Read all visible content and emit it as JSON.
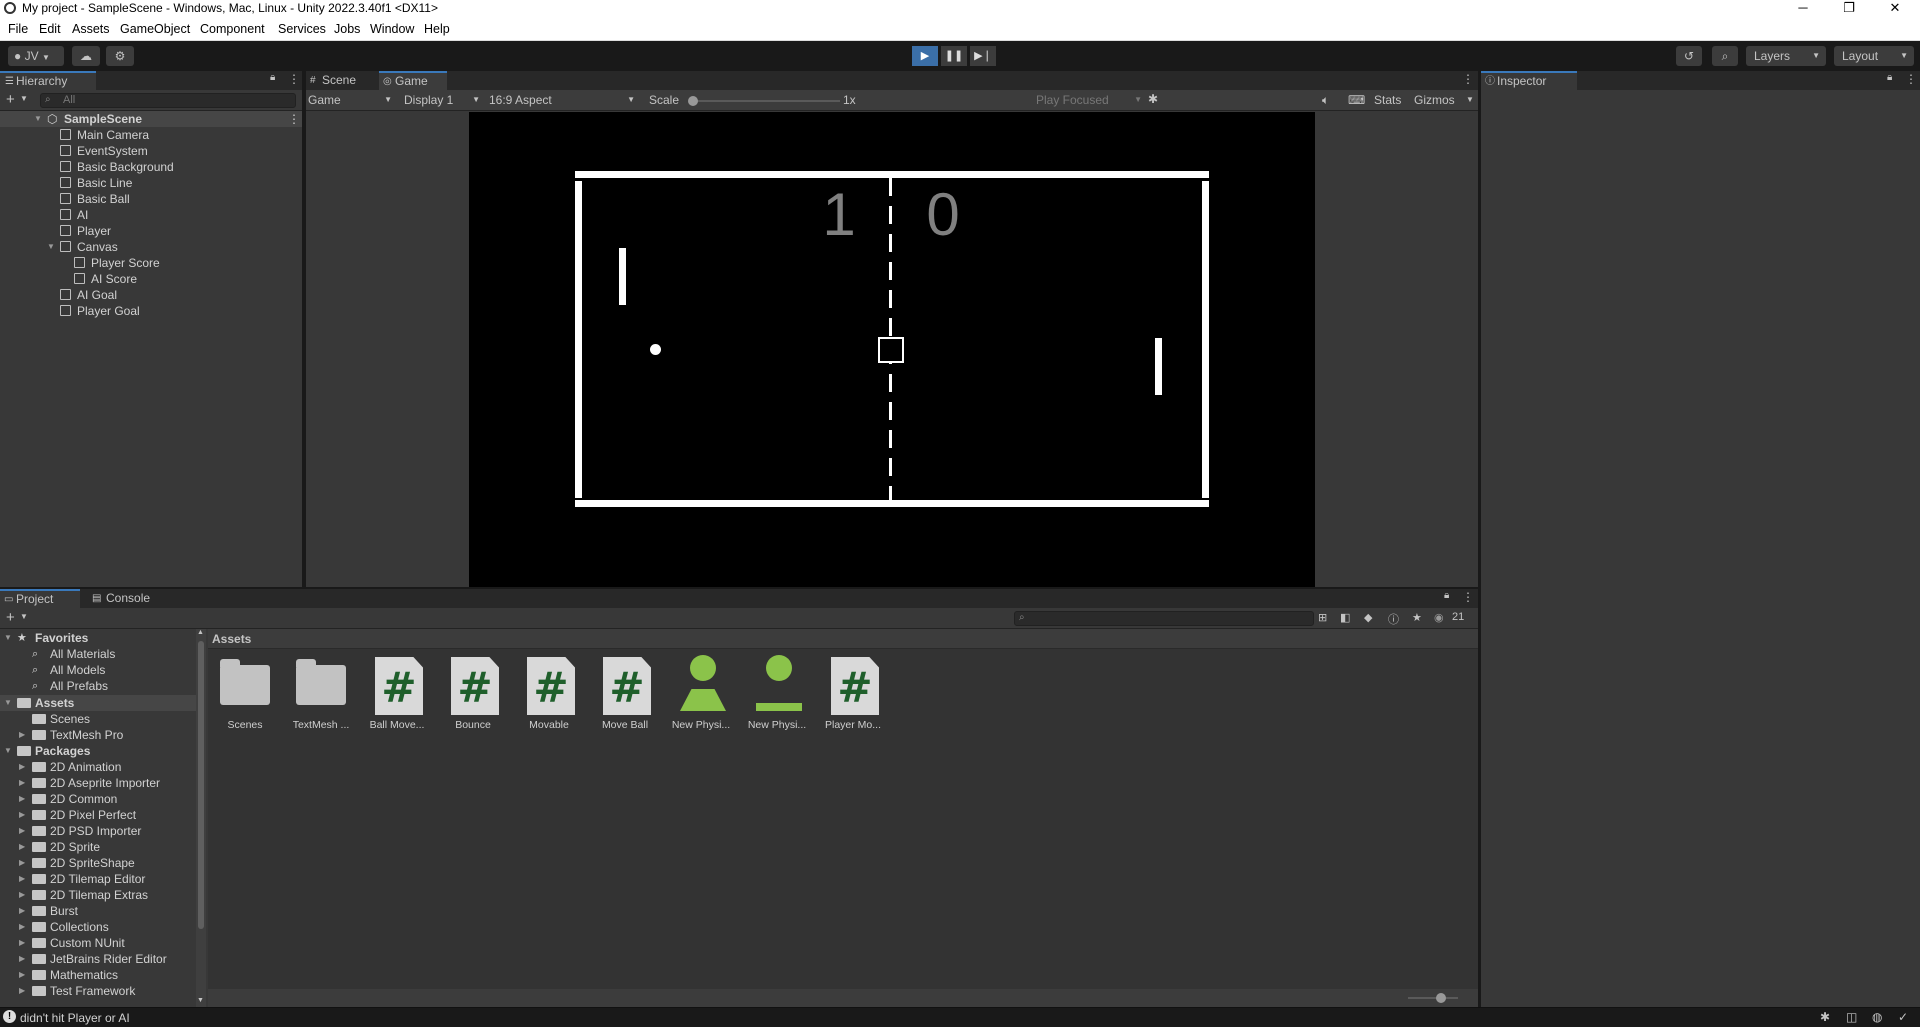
{
  "window": {
    "title": "My project - SampleScene - Windows, Mac, Linux - Unity 2022.3.40f1 <DX11>",
    "controls": [
      "─",
      "❐",
      "✕"
    ]
  },
  "menu": [
    "File",
    "Edit",
    "Assets",
    "GameObject",
    "Component",
    "Services",
    "Jobs",
    "Window",
    "Help"
  ],
  "toolbar": {
    "account": "JV",
    "layers": "Layers",
    "layout": "Layout"
  },
  "hierarchy": {
    "tab": "Hierarchy",
    "search_placeholder": "All",
    "scene": "SampleScene",
    "items": [
      {
        "label": "Main Camera",
        "indent": 1
      },
      {
        "label": "EventSystem",
        "indent": 1
      },
      {
        "label": "Basic Background",
        "indent": 1
      },
      {
        "label": "Basic Line",
        "indent": 1
      },
      {
        "label": "Basic Ball",
        "indent": 1
      },
      {
        "label": "AI",
        "indent": 1
      },
      {
        "label": "Player",
        "indent": 1
      },
      {
        "label": "Canvas",
        "indent": 1
      },
      {
        "label": "Player Score",
        "indent": 2
      },
      {
        "label": "AI Score",
        "indent": 2
      },
      {
        "label": "AI Goal",
        "indent": 1
      },
      {
        "label": "Player Goal",
        "indent": 1
      }
    ]
  },
  "view_tabs": {
    "scene": "Scene",
    "game": "Game"
  },
  "game_toolbar": {
    "mode": "Game",
    "display": "Display 1",
    "aspect": "16:9 Aspect",
    "scale_label": "Scale",
    "scale_value": "1x",
    "play_focused": "Play Focused",
    "stats": "Stats",
    "gizmos": "Gizmos"
  },
  "game": {
    "player_score": "1",
    "ai_score": "0"
  },
  "inspector": {
    "tab": "Inspector"
  },
  "project": {
    "tabs": {
      "project": "Project",
      "console": "Console"
    },
    "hidden_count": "21",
    "breadcrumb": "Assets",
    "favorites": {
      "label": "Favorites",
      "items": [
        "All Materials",
        "All Models",
        "All Prefabs"
      ]
    },
    "assets_root": {
      "label": "Assets",
      "items": [
        "Scenes",
        "TextMesh Pro"
      ]
    },
    "packages": {
      "label": "Packages",
      "items": [
        "2D Animation",
        "2D Aseprite Importer",
        "2D Common",
        "2D Pixel Perfect",
        "2D PSD Importer",
        "2D Sprite",
        "2D SpriteShape",
        "2D Tilemap Editor",
        "2D Tilemap Extras",
        "Burst",
        "Collections",
        "Custom NUnit",
        "JetBrains Rider Editor",
        "Mathematics",
        "Test Framework"
      ]
    },
    "assets": [
      {
        "label": "Scenes",
        "kind": "folder"
      },
      {
        "label": "TextMesh ...",
        "kind": "folder"
      },
      {
        "label": "Ball Move...",
        "kind": "script"
      },
      {
        "label": "Bounce",
        "kind": "script"
      },
      {
        "label": "Movable",
        "kind": "script"
      },
      {
        "label": "Move Ball",
        "kind": "script"
      },
      {
        "label": "New Physi...",
        "kind": "physics-material"
      },
      {
        "label": "New Physi...",
        "kind": "physics-material-2d"
      },
      {
        "label": "Player Mo...",
        "kind": "script"
      }
    ]
  },
  "status": {
    "message": "didn't hit Player or AI"
  }
}
